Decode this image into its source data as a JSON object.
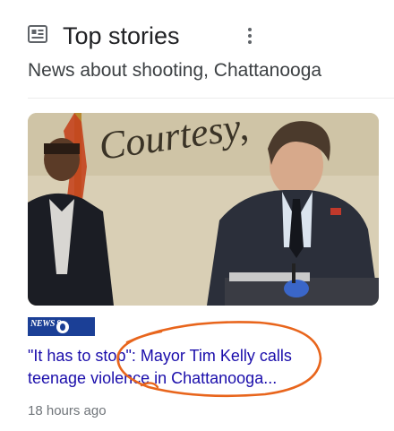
{
  "header": {
    "title": "Top stories",
    "icon": "newspaper-icon",
    "more_icon": "more-vertical-icon"
  },
  "subtitle": "News about shooting, Chattanooga",
  "story": {
    "source": "NEWS 9",
    "headline_line1": "\"It has to stop\": Mayor Tim Kelly calls",
    "headline_line2": "teenage violence in Chattanooga...",
    "time": "18 hours ago",
    "image_sign_text": "Courtesy,"
  },
  "colors": {
    "title": "#202124",
    "headline": "#1a0dab",
    "meta": "#70757a",
    "annotation": "#e8651c",
    "source_bg": "#1b3f96"
  }
}
